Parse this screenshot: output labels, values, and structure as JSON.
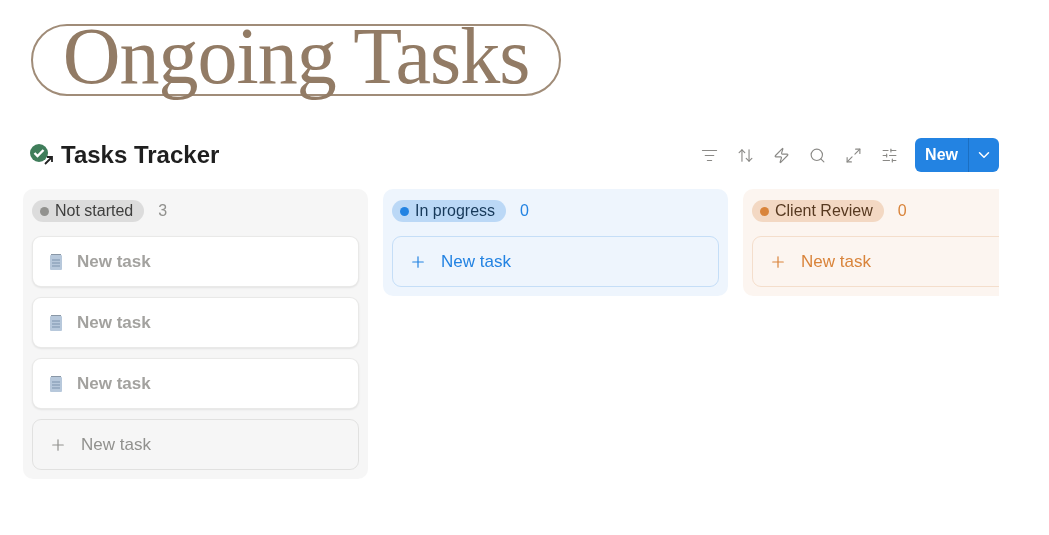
{
  "banner": {
    "title": "Ongoing Tasks"
  },
  "database": {
    "title": "Tasks Tracker",
    "new_button": "New"
  },
  "groups": [
    {
      "label": "Not started",
      "count": "3",
      "color": "#91918e",
      "cards": [
        {
          "kind": "page",
          "title": "New task"
        },
        {
          "kind": "page",
          "title": "New task"
        },
        {
          "kind": "page",
          "title": "New task"
        },
        {
          "kind": "add",
          "title": "New task"
        }
      ]
    },
    {
      "label": "In progress",
      "count": "0",
      "color": "#2383e2",
      "cards": [
        {
          "kind": "add",
          "title": "New task"
        }
      ]
    },
    {
      "label": "Client Review",
      "count": "0",
      "color": "#d9843b",
      "cards": [
        {
          "kind": "add",
          "title": "New task"
        }
      ]
    }
  ]
}
